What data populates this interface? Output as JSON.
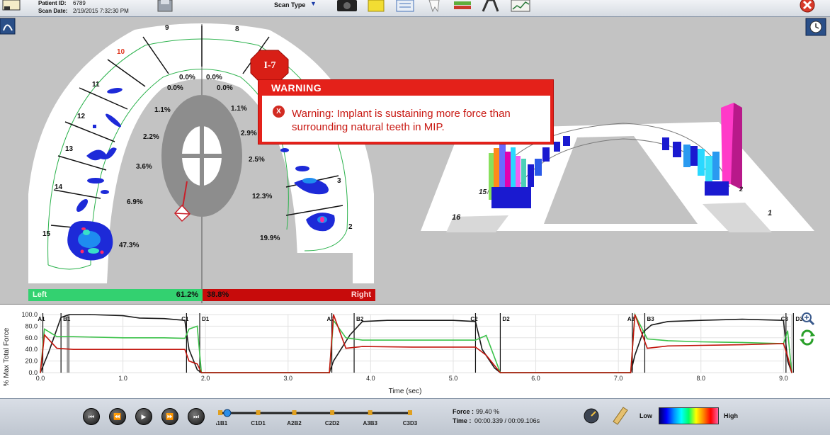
{
  "header": {
    "patient_id_label": "Patient ID:",
    "patient_id": "6789",
    "scan_date_label": "Scan Date:",
    "scan_date": "2/19/2015 7:32:30 PM",
    "scan_type_label": "Scan Type"
  },
  "arch": {
    "tooth_numbers": [
      "9",
      "8",
      "10",
      "11",
      "12",
      "13",
      "14",
      "15",
      "3",
      "2"
    ],
    "left_percents": [
      "0.0%",
      "0.0%",
      "1.1%",
      "2.2%",
      "3.6%",
      "6.9%",
      "47.3%"
    ],
    "right_percents": [
      "0.0%",
      "0.0%",
      "1.1%",
      "2.9%",
      "2.5%",
      "12.3%",
      "19.9%"
    ],
    "implant_label": "I-7"
  },
  "warning": {
    "title": "WARNING",
    "icon_glyph": "X",
    "message": "Warning: Implant is sustaining more force than surrounding natural teeth in MIP."
  },
  "balance": {
    "left_label": "Left",
    "left_value": "61.2%",
    "right_value": "38.8%",
    "right_label": "Right"
  },
  "view3d": {
    "tooth_labels": [
      "16",
      "1",
      "15",
      "2"
    ]
  },
  "chart_data": {
    "type": "line",
    "ylabel": "% Max Total Force",
    "xlabel": "Time (sec)",
    "xlim": [
      0,
      9.1
    ],
    "ylim": [
      0,
      100
    ],
    "xticks": [
      "0.0",
      "1.0",
      "2.0",
      "3.0",
      "4.0",
      "5.0",
      "6.0",
      "7.0",
      "8.0",
      "9.0"
    ],
    "yticks": [
      "100.0",
      "80.0",
      "60.0",
      "40.0",
      "20.0",
      "0.0"
    ],
    "markers": [
      {
        "label": "A1",
        "t": 0.03
      },
      {
        "label": "B1",
        "t": 0.25
      },
      {
        "label": "C1",
        "t": 1.77
      },
      {
        "label": "D1",
        "t": 1.93
      },
      {
        "label": "A2",
        "t": 3.53
      },
      {
        "label": "B2",
        "t": 3.8
      },
      {
        "label": "C2",
        "t": 5.27
      },
      {
        "label": "D2",
        "t": 5.57
      },
      {
        "label": "A3",
        "t": 7.17
      },
      {
        "label": "B3",
        "t": 7.32
      },
      {
        "label": "C3",
        "t": 9.03
      },
      {
        "label": "D3",
        "t": 9.12
      }
    ],
    "series": [
      {
        "color": "#1a1a1a",
        "x": [
          0.0,
          0.1,
          0.25,
          0.35,
          0.6,
          1.0,
          1.2,
          1.5,
          1.75,
          1.8,
          1.9,
          1.95,
          3.5,
          3.55,
          3.75,
          3.9,
          4.2,
          4.6,
          5.0,
          5.27,
          5.35,
          5.5,
          5.57,
          7.15,
          7.2,
          7.3,
          7.4,
          7.6,
          8.0,
          8.5,
          9.0,
          9.05,
          9.1
        ],
        "y": [
          0,
          35,
          95,
          100,
          100,
          98,
          94,
          93,
          90,
          40,
          5,
          0,
          0,
          20,
          65,
          88,
          90,
          90,
          90,
          88,
          40,
          8,
          0,
          0,
          30,
          70,
          82,
          88,
          90,
          92,
          90,
          20,
          0
        ]
      },
      {
        "color": "#3cc24a",
        "x": [
          0.0,
          0.05,
          0.2,
          0.4,
          1.0,
          1.5,
          1.75,
          1.8,
          1.9,
          1.95,
          3.5,
          3.55,
          3.7,
          3.9,
          4.5,
          5.0,
          5.27,
          5.4,
          5.57,
          7.15,
          7.2,
          7.35,
          7.6,
          8.0,
          8.5,
          9.0,
          9.05,
          9.1
        ],
        "y": [
          0,
          75,
          62,
          62,
          60,
          60,
          59,
          75,
          80,
          0,
          0,
          90,
          60,
          56,
          56,
          56,
          56,
          64,
          0,
          0,
          100,
          58,
          55,
          53,
          52,
          50,
          72,
          0
        ]
      },
      {
        "color": "#c2140c",
        "x": [
          0.0,
          0.05,
          0.2,
          0.4,
          1.0,
          1.5,
          1.75,
          1.8,
          1.9,
          1.95,
          3.5,
          3.55,
          3.7,
          3.9,
          4.5,
          5.0,
          5.27,
          5.4,
          5.57,
          7.15,
          7.2,
          7.35,
          7.6,
          8.0,
          8.5,
          9.0,
          9.05,
          9.1
        ],
        "y": [
          0,
          65,
          42,
          40,
          40,
          40,
          40,
          20,
          15,
          0,
          0,
          100,
          42,
          45,
          44,
          44,
          44,
          30,
          0,
          0,
          100,
          42,
          46,
          47,
          48,
          50,
          28,
          0
        ]
      }
    ]
  },
  "playback": {
    "timeline_labels": [
      "A1B1",
      "C1D1",
      "A2B2",
      "C2D2",
      "A3B3",
      "C3D3"
    ],
    "progress": 0.037,
    "force_label": "Force :",
    "force_value": "99.40 %",
    "time_label": "Time :",
    "time_value": "00:00.339 / 00:09.106s",
    "legend_low": "Low",
    "legend_high": "High"
  },
  "colors": {
    "warning_red": "#e4211a",
    "left_green": "#33d170",
    "right_red": "#c70b0b",
    "arch_outline": "#2bb24c"
  }
}
